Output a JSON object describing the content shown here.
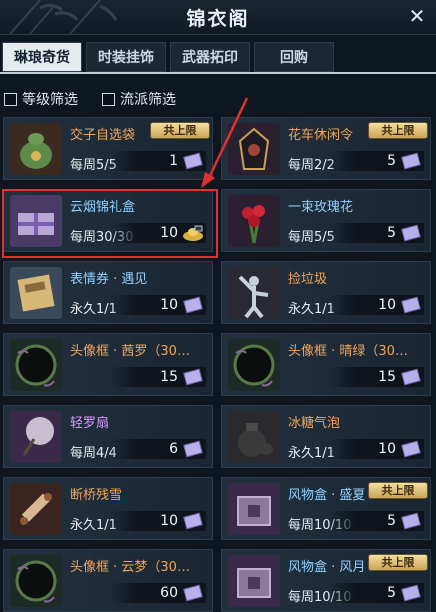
{
  "window": {
    "title": "锦衣阁"
  },
  "tabs": [
    {
      "label": "琳琅奇货",
      "active": true
    },
    {
      "label": "时装挂饰",
      "active": false
    },
    {
      "label": "武器拓印",
      "active": false
    },
    {
      "label": "回购",
      "active": false
    }
  ],
  "filters": [
    {
      "label": "等级筛选",
      "checked": false
    },
    {
      "label": "流派筛选",
      "checked": false
    }
  ],
  "items": [
    {
      "name": "交子自选袋",
      "limit": "每周5/5",
      "price": "1",
      "badge": "共上限",
      "name_color": "orange",
      "icon": "money-pouch-icon",
      "currency": "ticket"
    },
    {
      "name": "花车休闲令",
      "limit": "每周2/2",
      "price": "5",
      "badge": "共上限",
      "name_color": "orange",
      "icon": "token-icon",
      "currency": "ticket"
    },
    {
      "name": "云烟锦礼盒",
      "limit": "每周30/30",
      "price": "10",
      "badge": "",
      "name_color": "blue",
      "icon": "gift-box-icon",
      "currency": "gold"
    },
    {
      "name": "一束玫瑰花",
      "limit": "每周5/5",
      "price": "5",
      "badge": "",
      "name_color": "blue",
      "icon": "rose-bouquet-icon",
      "currency": "ticket"
    },
    {
      "name": "表情券 · 遇见",
      "limit": "永久1/1",
      "price": "10",
      "badge": "",
      "name_color": "blue",
      "icon": "scroll-ticket-icon",
      "currency": "ticket"
    },
    {
      "name": "捡垃圾",
      "limit": "永久1/1",
      "price": "10",
      "badge": "",
      "name_color": "orange",
      "icon": "statue-icon",
      "currency": "ticket"
    },
    {
      "name": "头像框 · 茜罗（30…",
      "limit": "",
      "price": "15",
      "badge": "",
      "name_color": "orange",
      "icon": "avatar-frame-icon",
      "currency": "ticket"
    },
    {
      "name": "头像框 · 晴绿（30…",
      "limit": "",
      "price": "15",
      "badge": "",
      "name_color": "orange",
      "icon": "avatar-frame-icon",
      "currency": "ticket"
    },
    {
      "name": "轻罗扇",
      "limit": "每周4/4",
      "price": "6",
      "badge": "",
      "name_color": "purple",
      "icon": "fan-icon",
      "currency": "ticket"
    },
    {
      "name": "冰糖气泡",
      "limit": "永久1/1",
      "price": "10",
      "badge": "",
      "name_color": "orange",
      "icon": "jar-icon",
      "currency": "ticket"
    },
    {
      "name": "断桥残雪",
      "limit": "永久1/1",
      "price": "10",
      "badge": "",
      "name_color": "orange",
      "icon": "scroll-icon",
      "currency": "ticket"
    },
    {
      "name": "风物盒 · 盛夏",
      "limit": "每周10/10",
      "price": "5",
      "badge": "共上限",
      "name_color": "blue",
      "icon": "treasure-box-icon",
      "currency": "ticket"
    },
    {
      "name": "头像框 · 云梦（30…",
      "limit": "",
      "price": "60",
      "badge": "",
      "name_color": "orange",
      "icon": "avatar-frame-icon",
      "currency": "ticket"
    },
    {
      "name": "风物盒 · 风月",
      "limit": "每周10/10",
      "price": "5",
      "badge": "共上限",
      "name_color": "blue",
      "icon": "treasure-box-icon",
      "currency": "ticket"
    }
  ],
  "colors": {
    "orange": "#f0a55a",
    "blue": "#8fd0ff",
    "purple": "#d49bff",
    "highlight": "#e03030",
    "active_tab": "#e6ebf0"
  }
}
